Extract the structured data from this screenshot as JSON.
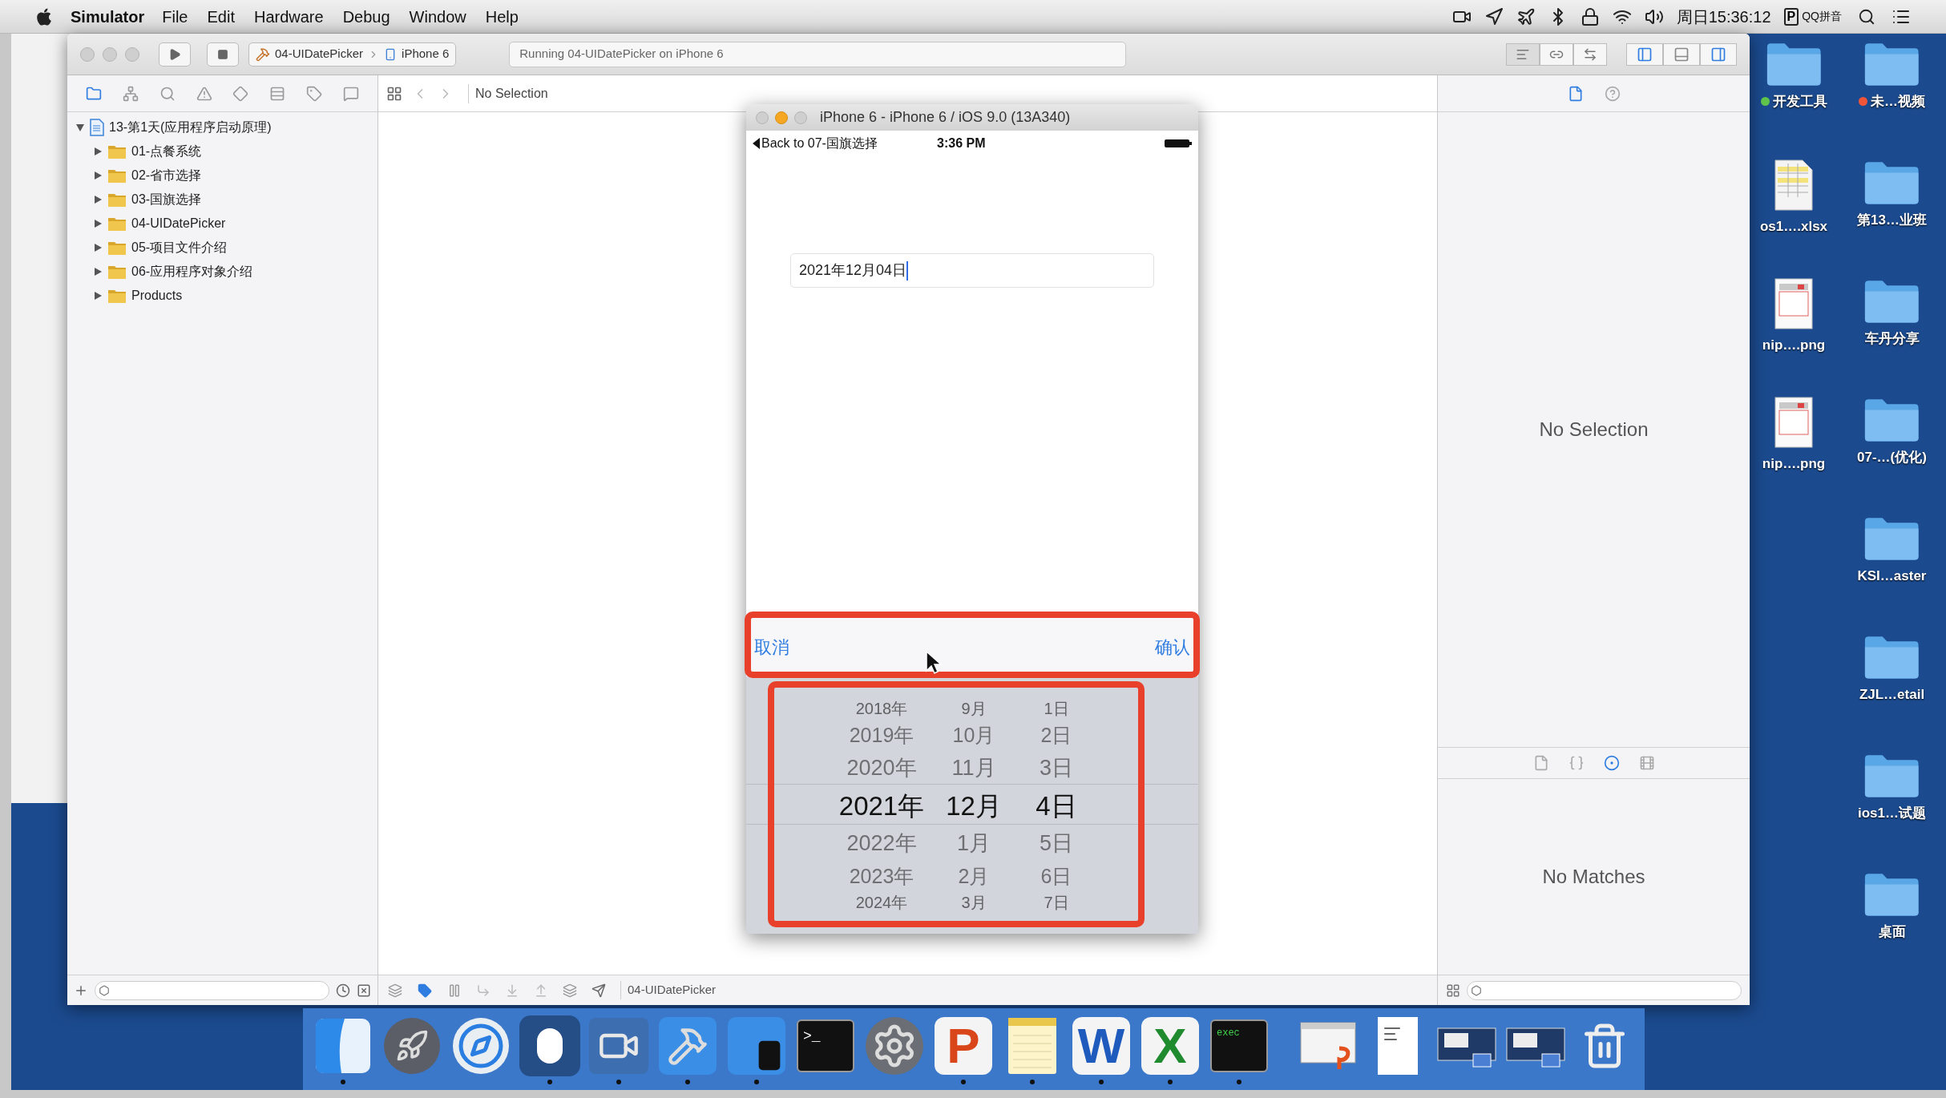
{
  "menu_bar": {
    "app": "Simulator",
    "menus": [
      "File",
      "Edit",
      "Hardware",
      "Debug",
      "Window",
      "Help"
    ],
    "clock": "周日15:36:12",
    "input_badge": "P",
    "input_method": "QQ拼音"
  },
  "xcode": {
    "scheme": "04-UIDatePicker",
    "device": "iPhone 6",
    "activity": "Running 04-UIDatePicker on iPhone 6",
    "editor_modes": [
      {
        "kind": "standard",
        "selected": true
      },
      {
        "kind": "assistant",
        "selected": false
      },
      {
        "kind": "version",
        "selected": false
      }
    ],
    "panels": [
      {
        "kind": "navigator",
        "on": true
      },
      {
        "kind": "debug",
        "on": false
      },
      {
        "kind": "utilities",
        "on": true
      }
    ],
    "navigator_tabs": [
      {
        "kind": "folder",
        "selected": true
      },
      {
        "kind": "symbols",
        "selected": false
      },
      {
        "kind": "search",
        "selected": false
      },
      {
        "kind": "issues",
        "selected": false
      },
      {
        "kind": "tests",
        "selected": false
      },
      {
        "kind": "debug",
        "selected": false
      },
      {
        "kind": "breakpoints",
        "selected": false
      },
      {
        "kind": "reports",
        "selected": false
      }
    ],
    "tree": [
      {
        "label": "13-第1天(应用程序启动原理)",
        "kind": "project",
        "expanded": true,
        "children": [
          {
            "label": "01-点餐系统",
            "kind": "folder",
            "expanded": false
          },
          {
            "label": "02-省市选择",
            "kind": "folder",
            "expanded": false
          },
          {
            "label": "03-国旗选择",
            "kind": "folder",
            "expanded": false
          },
          {
            "label": "04-UIDatePicker",
            "kind": "folder",
            "expanded": false
          },
          {
            "label": "05-项目文件介绍",
            "kind": "folder",
            "expanded": false
          },
          {
            "label": "06-应用程序对象介绍",
            "kind": "folder",
            "expanded": false
          },
          {
            "label": "Products",
            "kind": "folder",
            "expanded": false
          }
        ]
      }
    ],
    "jump_bar": "No Selection",
    "debug_bar": {
      "breakpoints_active": true,
      "target": "04-UIDatePicker"
    },
    "inspector_tabs": [
      {
        "kind": "file",
        "selected": true
      },
      {
        "kind": "help",
        "selected": false
      }
    ],
    "inspector_message": "No Selection",
    "library_tabs": [
      {
        "kind": "file",
        "selected": false
      },
      {
        "kind": "code",
        "selected": false
      },
      {
        "kind": "object",
        "selected": true
      },
      {
        "kind": "media",
        "selected": false
      }
    ],
    "library_message": "No Matches"
  },
  "simulator": {
    "title": "iPhone 6 - iPhone 6 / iOS 9.0 (13A340)",
    "back": "Back to 07-国旗选择",
    "time": "3:36 PM",
    "text_field": {
      "value": "2021年12月04日"
    },
    "cancel": "取消",
    "confirm": "确认",
    "picker": [
      {
        "items": [
          {
            "label": "2018年",
            "selected": false
          },
          {
            "label": "2019年",
            "selected": false
          },
          {
            "label": "2020年",
            "selected": false
          },
          {
            "label": "2021年",
            "selected": true
          },
          {
            "label": "2022年",
            "selected": false
          },
          {
            "label": "2023年",
            "selected": false
          },
          {
            "label": "2024年",
            "selected": false
          }
        ]
      },
      {
        "items": [
          {
            "label": "9月",
            "selected": false
          },
          {
            "label": "10月",
            "selected": false
          },
          {
            "label": "11月",
            "selected": false
          },
          {
            "label": "12月",
            "selected": true
          },
          {
            "label": "1月",
            "selected": false
          },
          {
            "label": "2月",
            "selected": false
          },
          {
            "label": "3月",
            "selected": false
          }
        ]
      },
      {
        "items": [
          {
            "label": "1日",
            "selected": false
          },
          {
            "label": "2日",
            "selected": false
          },
          {
            "label": "3日",
            "selected": false
          },
          {
            "label": "4日",
            "selected": true
          },
          {
            "label": "5日",
            "selected": false
          },
          {
            "label": "6日",
            "selected": false
          },
          {
            "label": "7日",
            "selected": false
          }
        ]
      }
    ]
  },
  "desktop": {
    "column_1": [
      {
        "label": "开发工具",
        "kind": "folder",
        "color": "#5ec24b"
      },
      {
        "label": "os1….xlsx",
        "kind": "spreadsheet"
      },
      {
        "label": "nip….png",
        "kind": "image"
      },
      {
        "label": "nip….png",
        "kind": "image"
      }
    ],
    "column_2": [
      {
        "label": "未…视频",
        "kind": "folder",
        "color": "#f0553a"
      },
      {
        "label": "第13…业班",
        "kind": "folder"
      },
      {
        "label": "车丹分享",
        "kind": "folder"
      },
      {
        "label": "07-…(优化)",
        "kind": "folder"
      },
      {
        "label": "KSI…aster",
        "kind": "folder"
      },
      {
        "label": "ZJL…etail",
        "kind": "folder"
      },
      {
        "label": "ios1…试题",
        "kind": "folder"
      },
      {
        "label": "桌面",
        "kind": "folder"
      }
    ]
  },
  "dock": [
    {
      "kind": "finder",
      "running": true
    },
    {
      "kind": "launchpad",
      "running": false
    },
    {
      "kind": "safari",
      "running": false
    },
    {
      "kind": "mouse",
      "running": true
    },
    {
      "kind": "movie",
      "running": true
    },
    {
      "kind": "xcode",
      "running": true
    },
    {
      "kind": "simulator",
      "running": true
    },
    {
      "kind": "terminal",
      "glyph": ">_",
      "running": false
    },
    {
      "kind": "settings",
      "running": false
    },
    {
      "kind": "presentation",
      "glyph": "P",
      "running": true
    },
    {
      "kind": "notes",
      "running": true
    },
    {
      "kind": "word",
      "glyph": "W",
      "running": true
    },
    {
      "kind": "excel",
      "glyph": "X",
      "running": true
    },
    {
      "kind": "console",
      "glyph": "exec",
      "running": true
    },
    {
      "kind": "separator"
    },
    {
      "kind": "doc-window",
      "running": false
    },
    {
      "kind": "text-file",
      "running": false
    },
    {
      "kind": "screen-capture",
      "running": false
    },
    {
      "kind": "screen-capture",
      "running": false
    },
    {
      "kind": "trash",
      "running": false
    }
  ]
}
